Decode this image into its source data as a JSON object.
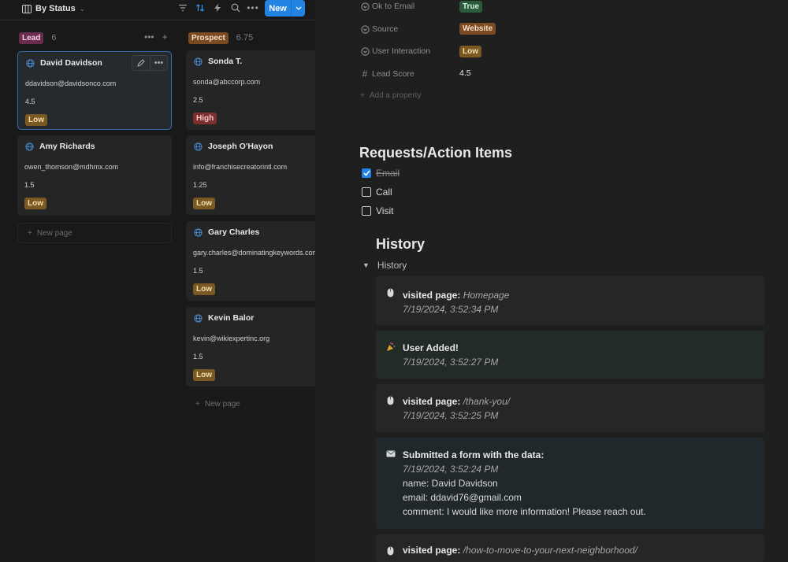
{
  "toolbar": {
    "view_label": "By Status",
    "new_label": "New"
  },
  "columns": [
    {
      "tag": "Lead",
      "count": "6"
    },
    {
      "tag": "Prospect",
      "count": "6.75"
    }
  ],
  "lead_cards": [
    {
      "name": "David Davidson",
      "email": "ddavidson@davidsonco.com",
      "score": "4.5",
      "priority": "Low"
    },
    {
      "name": "Amy Richards",
      "email": "owen_thomson@mdhmx.com",
      "score": "1.5",
      "priority": "Low"
    }
  ],
  "prospect_cards": [
    {
      "name": "Sonda T.",
      "email": "sonda@abccorp.com",
      "score": "2.5",
      "priority": "High"
    },
    {
      "name": "Joseph O'Hayon",
      "email": "info@franchisecreatorintl.com",
      "score": "1.25",
      "priority": "Low"
    },
    {
      "name": "Gary Charles",
      "email": "gary.charles@dominatingkeywords.com",
      "score": "1.5",
      "priority": "Low"
    },
    {
      "name": "Kevin Balor",
      "email": "kevin@wikiexpertinc.org",
      "score": "1.5",
      "priority": "Low"
    }
  ],
  "new_page_label": "New page",
  "properties": [
    {
      "label": "Ok to Email",
      "value": "True"
    },
    {
      "label": "Source",
      "value": "Website"
    },
    {
      "label": "User Interaction",
      "value": "Low"
    },
    {
      "label": "Lead Score",
      "value": "4.5"
    }
  ],
  "add_property_label": "Add a property",
  "requests": {
    "heading": "Requests/Action Items",
    "items": [
      {
        "label": "Email",
        "checked": true
      },
      {
        "label": "Call",
        "checked": false
      },
      {
        "label": "Visit",
        "checked": false
      }
    ]
  },
  "history": {
    "heading": "History",
    "toggle_label": "History",
    "entries": [
      {
        "icon": "mouse-icon",
        "title": "visited page:",
        "detail": "Homepage",
        "time": "7/19/2024, 3:52:34 PM"
      },
      {
        "icon": "party-icon",
        "title": "User Added!",
        "detail": "",
        "time": "7/19/2024, 3:52:27 PM"
      },
      {
        "icon": "mouse-icon",
        "title": "visited page:",
        "detail": "/thank-you/",
        "time": "7/19/2024, 3:52:25 PM"
      },
      {
        "icon": "envelope-icon",
        "title": "Submitted a form with the data:",
        "detail": "",
        "time": "7/19/2024, 3:52:24 PM",
        "lines": [
          "name: David Davidson",
          "email: ddavid76@gmail.com",
          "comment: I would like more information! Please reach out."
        ]
      },
      {
        "icon": "mouse-icon",
        "title": "visited page:",
        "detail": "/how-to-move-to-your-next-neighborhood/",
        "time": ""
      }
    ]
  },
  "colors": {
    "accent": "#2383e2",
    "lead_tag": "#6b2c4f",
    "prospect_tag": "#7a4a22",
    "low_tag": "#7a5a22",
    "high_tag": "#7d2e2e",
    "true_tag": "#2b5b3c"
  }
}
